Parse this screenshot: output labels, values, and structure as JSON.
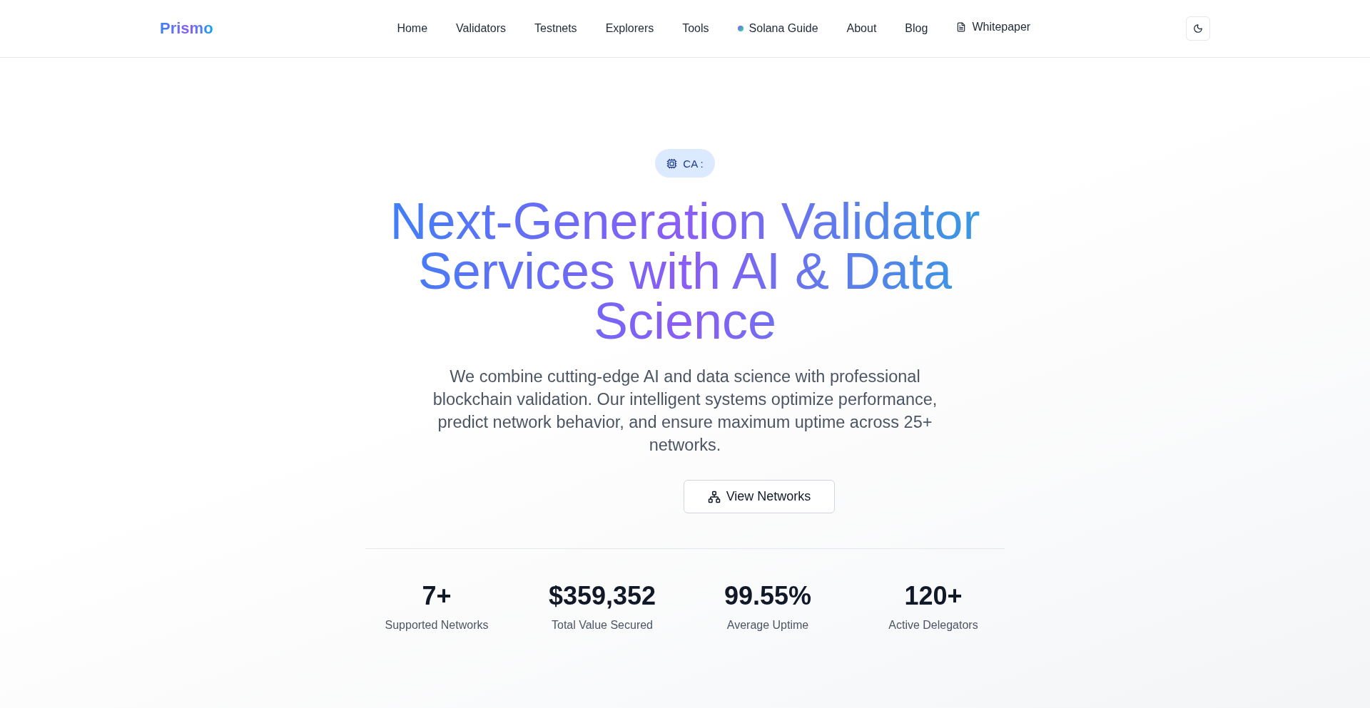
{
  "header": {
    "logo": "Prismo",
    "nav": [
      {
        "label": "Home",
        "kind": "plain"
      },
      {
        "label": "Validators",
        "kind": "plain"
      },
      {
        "label": "Testnets",
        "kind": "plain"
      },
      {
        "label": "Explorers",
        "kind": "plain"
      },
      {
        "label": "Tools",
        "kind": "plain"
      },
      {
        "label": "Solana Guide",
        "kind": "dot"
      },
      {
        "label": "About",
        "kind": "plain"
      },
      {
        "label": "Blog",
        "kind": "plain"
      },
      {
        "label": "Whitepaper",
        "kind": "document"
      }
    ],
    "theme_toggle": {
      "dark": false
    }
  },
  "hero": {
    "badge": "CA :",
    "headline": "Next-Generation Validator Services with AI & Data Science",
    "description": "We combine cutting-edge AI and data science with professional blockchain validation. Our intelligent systems optimize performance, predict network behavior, and ensure maximum uptime across 25+ networks.",
    "button": "View Networks"
  },
  "stats": [
    {
      "value": "7+",
      "label": "Supported Networks"
    },
    {
      "value": "$359,352",
      "label": "Total Value Secured"
    },
    {
      "value": "99.55%",
      "label": "Average Uptime"
    },
    {
      "value": "120+",
      "label": "Active Delegators"
    }
  ]
}
